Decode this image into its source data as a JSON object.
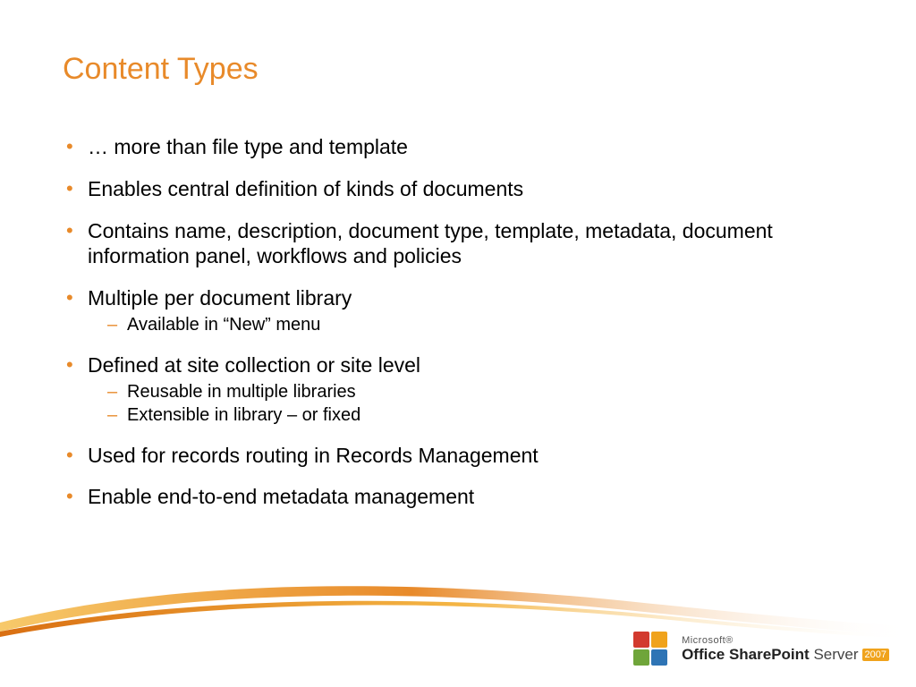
{
  "title": "Content Types",
  "bullets": [
    {
      "text": "… more than file type and template",
      "sub": []
    },
    {
      "text": "Enables central definition of kinds of documents",
      "sub": []
    },
    {
      "text": "Contains name, description, document type, template, metadata, document information panel, workflows and policies",
      "sub": []
    },
    {
      "text": "Multiple per document library",
      "sub": [
        "Available in “New” menu"
      ]
    },
    {
      "text": "Defined at site collection or site level",
      "sub": [
        "Reusable in multiple libraries",
        "Extensible in library – or fixed"
      ]
    },
    {
      "text": "Used for records routing in Records Management",
      "sub": []
    },
    {
      "text": "Enable end-to-end metadata management",
      "sub": []
    }
  ],
  "footer": {
    "brand_small": "Microsoft®",
    "product_bold": "Office SharePoint",
    "product_thin": "Server",
    "year": "2007"
  },
  "colors": {
    "accent": "#e88a2a"
  }
}
